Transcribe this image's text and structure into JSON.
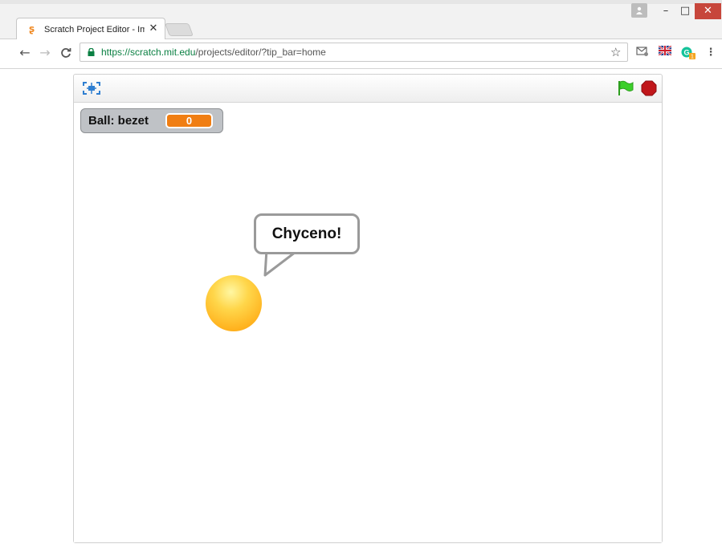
{
  "browser": {
    "tab_title": "Scratch Project Editor - Im",
    "tab_close": "✕",
    "url_scheme": "https://",
    "url_host": "scratch.mit.edu",
    "url_path": "/projects/editor/?tip_bar=home",
    "grammarly_badge": "1",
    "window_buttons": {
      "minimize": "–",
      "maximize": "□",
      "close": "✕"
    },
    "nav": {
      "back": "←",
      "forward": "→",
      "reload": "C"
    },
    "star": "☆",
    "menu": "⋮"
  },
  "player": {
    "monitor": {
      "label": "Ball: bezet",
      "value": "0"
    },
    "speech_bubble": "Chyceno!"
  },
  "colors": {
    "accent_orange": "#f07e13",
    "flag_green": "#3ccf2a",
    "stop_red": "#c0161a",
    "tab_close_red": "#c7463b",
    "secure_green": "#0b8043"
  },
  "icons": {
    "fullscreen": "fullscreen-icon",
    "green_flag": "green-flag-icon",
    "stop": "stop-sign-icon",
    "lock": "lock-icon",
    "star": "bookmark-star-icon"
  }
}
